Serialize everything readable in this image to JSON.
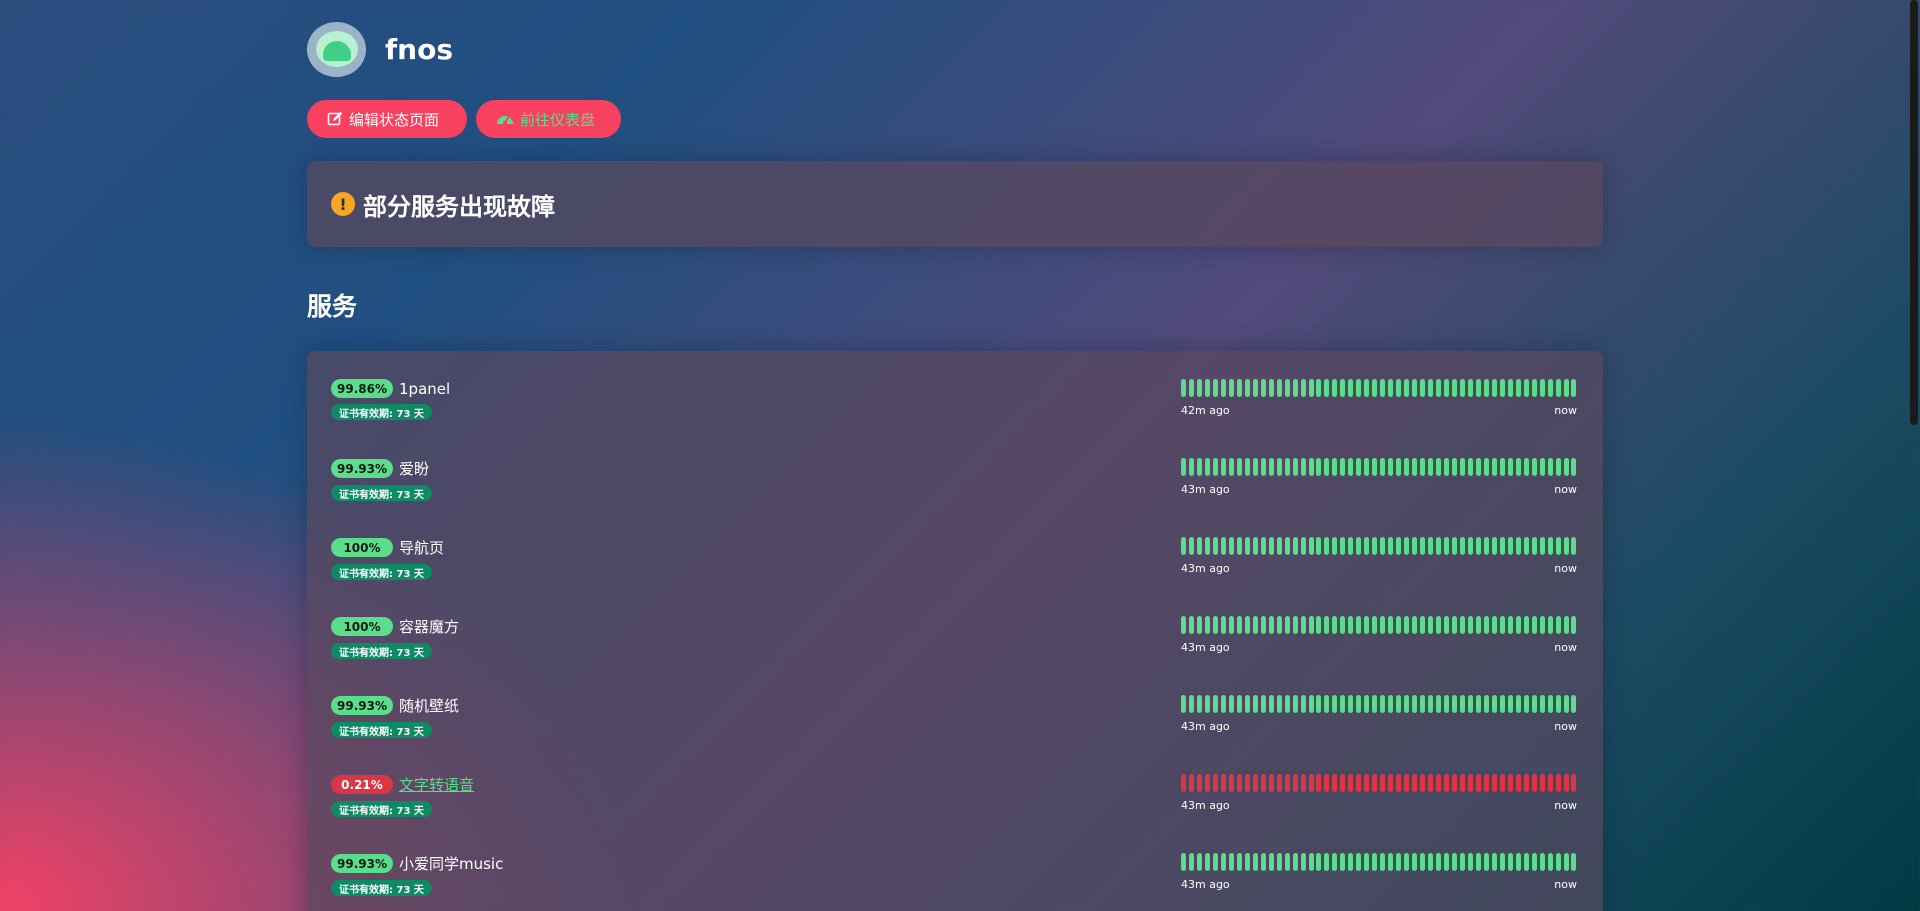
{
  "site": {
    "title": "fnos",
    "logo_icon": "fnos-logo-icon"
  },
  "actions": {
    "edit_label": "编辑状态页面",
    "dashboard_label": "前往仪表盘"
  },
  "alert": {
    "text": "部分服务出现故障",
    "icon": "exclamation-icon",
    "color": "#f5a623"
  },
  "section": {
    "title": "服务"
  },
  "colors": {
    "up": "#5cdd8b",
    "down": "#dc3545",
    "accent": "#f8405f",
    "cert": "#0e8a64"
  },
  "services": [
    {
      "uptime": "99.86%",
      "name": "1panel",
      "cert": "证书有效期: 73 天",
      "since": "42m ago",
      "now": "now",
      "status": "up",
      "link": false
    },
    {
      "uptime": "99.93%",
      "name": "爱盼",
      "cert": "证书有效期: 73 天",
      "since": "43m ago",
      "now": "now",
      "status": "up",
      "link": false
    },
    {
      "uptime": "100%",
      "name": "导航页",
      "cert": "证书有效期: 73 天",
      "since": "43m ago",
      "now": "now",
      "status": "up",
      "link": false
    },
    {
      "uptime": "100%",
      "name": "容器魔方",
      "cert": "证书有效期: 73 天",
      "since": "43m ago",
      "now": "now",
      "status": "up",
      "link": false
    },
    {
      "uptime": "99.93%",
      "name": "随机壁纸",
      "cert": "证书有效期: 73 天",
      "since": "43m ago",
      "now": "now",
      "status": "up",
      "link": false
    },
    {
      "uptime": "0.21%",
      "name": "文字转语音",
      "cert": "证书有效期: 73 天",
      "since": "43m ago",
      "now": "now",
      "status": "down",
      "link": true
    },
    {
      "uptime": "99.93%",
      "name": "小爱同学music",
      "cert": "证书有效期: 73 天",
      "since": "43m ago",
      "now": "now",
      "status": "up",
      "link": false
    }
  ]
}
